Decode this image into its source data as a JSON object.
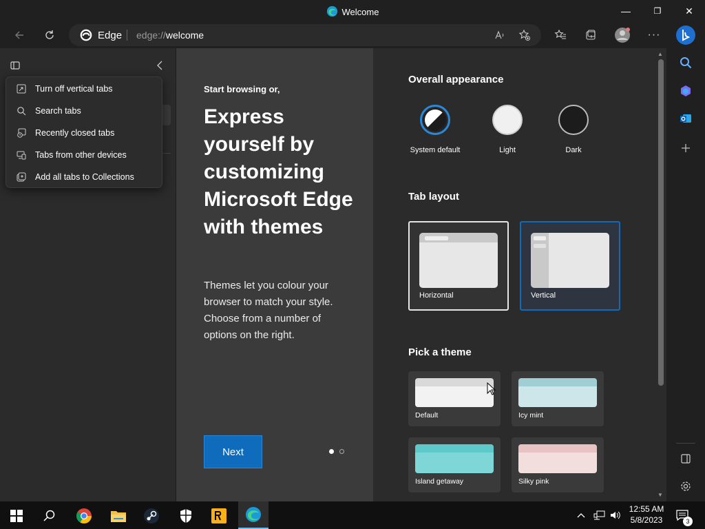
{
  "window": {
    "title": "Welcome",
    "minimize_glyph": "—",
    "restore_glyph": "❐",
    "close_glyph": "✕"
  },
  "toolbar": {
    "site_name": "Edge",
    "url_scheme": "edge://",
    "url_path": "welcome",
    "more_glyph": "···"
  },
  "vertical_tabs_menu": {
    "items": [
      {
        "label": "Turn off vertical tabs",
        "icon": "vertical-tabs-off-icon"
      },
      {
        "label": "Search tabs",
        "icon": "search-icon"
      },
      {
        "label": "Recently closed tabs",
        "icon": "recent-tabs-icon"
      },
      {
        "label": "Tabs from other devices",
        "icon": "devices-icon"
      },
      {
        "label": "Add all tabs to Collections",
        "icon": "collections-add-icon"
      }
    ]
  },
  "welcome": {
    "kicker": "Start browsing or,",
    "headline": "Express yourself by customizing Microsoft Edge with themes",
    "body": "Themes let you colour your browser to match your style. Choose from a number of options on the right.",
    "next_label": "Next"
  },
  "appearance": {
    "heading": "Overall appearance",
    "options": [
      {
        "label": "System default",
        "selected": true
      },
      {
        "label": "Light",
        "selected": false
      },
      {
        "label": "Dark",
        "selected": false
      }
    ]
  },
  "tab_layout": {
    "heading": "Tab layout",
    "options": [
      {
        "label": "Horizontal",
        "selected": false
      },
      {
        "label": "Vertical",
        "selected": true
      }
    ]
  },
  "themes": {
    "heading": "Pick a theme",
    "options": [
      {
        "label": "Default",
        "color": "#d9d9d9"
      },
      {
        "label": "Icy mint",
        "color": "#9fcfd4"
      },
      {
        "label": "Island getaway",
        "color": "#5ec9c9"
      },
      {
        "label": "Silky pink",
        "color": "#e8c3c3"
      }
    ]
  },
  "taskbar": {
    "clock_time": "12:55 AM",
    "clock_date": "5/8/2023",
    "notification_count": "3"
  },
  "colors": {
    "accent": "#0f6cbd",
    "selected_border": "#2b88d8"
  }
}
